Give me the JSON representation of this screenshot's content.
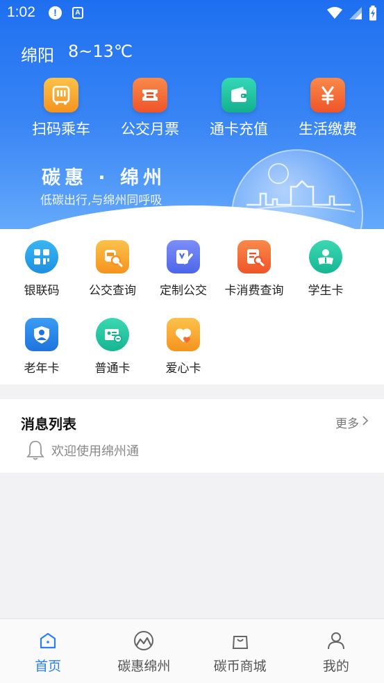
{
  "status": {
    "time": "1:02",
    "alert_glyph": "!",
    "a_glyph": "A"
  },
  "weather": {
    "city": "绵阳",
    "temp": "8~13℃"
  },
  "quick_actions": [
    {
      "label": "扫码乘车",
      "icon": "bus-qr-icon",
      "color": "#f7a23b"
    },
    {
      "label": "公交月票",
      "icon": "ticket-icon",
      "color": "#f26a36"
    },
    {
      "label": "通卡充值",
      "icon": "wallet-icon",
      "color": "#1fbf9f"
    },
    {
      "label": "生活缴费",
      "icon": "yen-icon",
      "color": "#f26a36"
    }
  ],
  "banner": {
    "title": "碳惠 · 绵州",
    "subtitle": "低碳出行,与绵州同呼吸"
  },
  "services": [
    {
      "label": "银联码",
      "icon": "unionpay-code-icon",
      "color": "#2aa1e8"
    },
    {
      "label": "公交查询",
      "icon": "bus-search-icon",
      "color": "#f7a23b"
    },
    {
      "label": "定制公交",
      "icon": "custom-bus-icon",
      "color": "#5f79f0"
    },
    {
      "label": "卡消费查询",
      "icon": "card-consume-search-icon",
      "color": "#f26a36"
    },
    {
      "label": "学生卡",
      "icon": "student-card-icon",
      "color": "#28c2a1"
    },
    {
      "label": "老年卡",
      "icon": "senior-card-icon",
      "color": "#2a86e8"
    },
    {
      "label": "普通卡",
      "icon": "normal-card-icon",
      "color": "#28c2a1"
    },
    {
      "label": "爱心卡",
      "icon": "love-card-icon",
      "color": "#f7a23b"
    }
  ],
  "messages": {
    "title": "消息列表",
    "more": "更多",
    "items": [
      {
        "text": "欢迎使用绵州通"
      }
    ]
  },
  "bottom_nav": [
    {
      "label": "首页",
      "icon": "home-icon",
      "active": true
    },
    {
      "label": "碳惠绵州",
      "icon": "carbon-icon",
      "active": false
    },
    {
      "label": "碳币商城",
      "icon": "shopping-bag-icon",
      "active": false
    },
    {
      "label": "我的",
      "icon": "user-icon",
      "active": false
    }
  ],
  "colors": {
    "accent": "#2a7ef4",
    "header_top": "#1e6ff0",
    "header_bottom": "#64a9fb"
  }
}
